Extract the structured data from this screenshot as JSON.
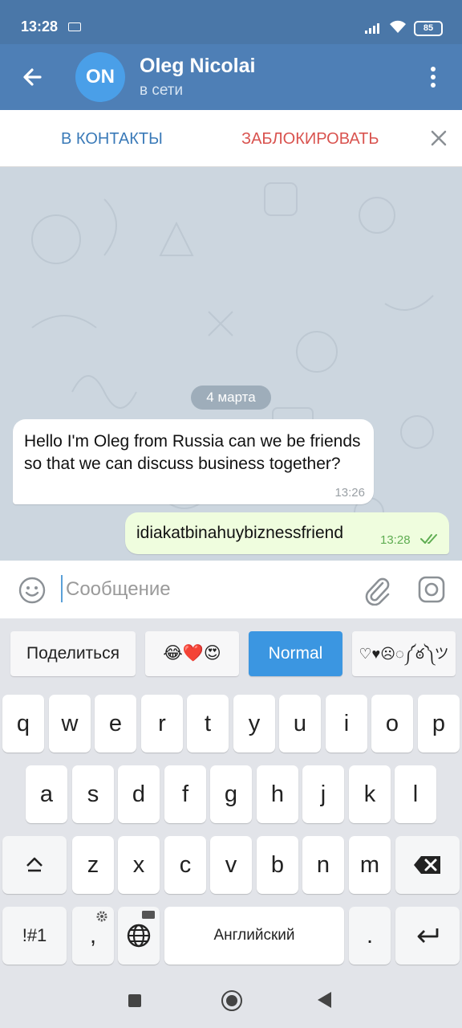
{
  "status_bar": {
    "time": "13:28",
    "battery": "85"
  },
  "header": {
    "avatar_initials": "ON",
    "name": "Oleg Nicolai",
    "status": "в сети"
  },
  "action_bar": {
    "add_contact": "В КОНТАКТЫ",
    "block": "ЗАБЛОКИРОВАТЬ"
  },
  "chat": {
    "date": "4 марта",
    "messages": [
      {
        "direction": "incoming",
        "text": "Hello I'm Oleg from Russia can we be friends so that we can discuss business together?",
        "time": "13:26"
      },
      {
        "direction": "outgoing",
        "text": "idiakatbinahuybiznessfriend",
        "time": "13:28"
      }
    ]
  },
  "input": {
    "placeholder": "Сообщение",
    "value": ""
  },
  "keyboard": {
    "suggestions": [
      "Поделиться",
      "😂❤️😍",
      "Normal",
      "♡♥☹◌༼ఠ༽ツ"
    ],
    "row1": [
      "q",
      "w",
      "e",
      "r",
      "t",
      "y",
      "u",
      "i",
      "o",
      "p"
    ],
    "row2": [
      "a",
      "s",
      "d",
      "f",
      "g",
      "h",
      "j",
      "k",
      "l"
    ],
    "row3": [
      "z",
      "x",
      "c",
      "v",
      "b",
      "n",
      "m"
    ],
    "symbols_key": "!#1",
    "comma_key": ",",
    "space_label": "Английский",
    "period_key": "."
  },
  "colors": {
    "header_bg": "#4e7fb6",
    "avatar_bg": "#4a9fe8",
    "contact_action": "#3a7ab8",
    "block_action": "#d9534f",
    "outgoing_bubble": "#effdde",
    "active_suggestion": "#3b96e1"
  }
}
